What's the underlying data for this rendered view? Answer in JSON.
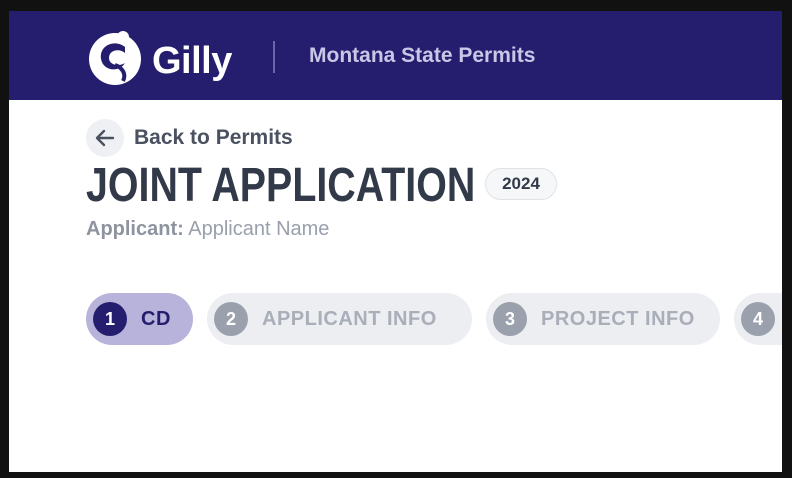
{
  "header": {
    "logo_text": "Gilly",
    "title": "Montana State Permits"
  },
  "back": {
    "label": "Back to Permits",
    "icon": "arrow-left-icon"
  },
  "page": {
    "title": "JOINT APPLICATION",
    "year_badge": "2024",
    "applicant_label": "Applicant:",
    "applicant_value": "Applicant Name"
  },
  "steps": [
    {
      "number": "1",
      "label": "CD",
      "active": true
    },
    {
      "number": "2",
      "label": "APPLICANT INFO",
      "active": false
    },
    {
      "number": "3",
      "label": "PROJECT INFO",
      "active": false
    },
    {
      "number": "4",
      "label": "",
      "active": false
    }
  ],
  "colors": {
    "brand": "#251e6e",
    "active_step_bg": "#b7b3da",
    "inactive_step_bg": "#eceef2"
  }
}
